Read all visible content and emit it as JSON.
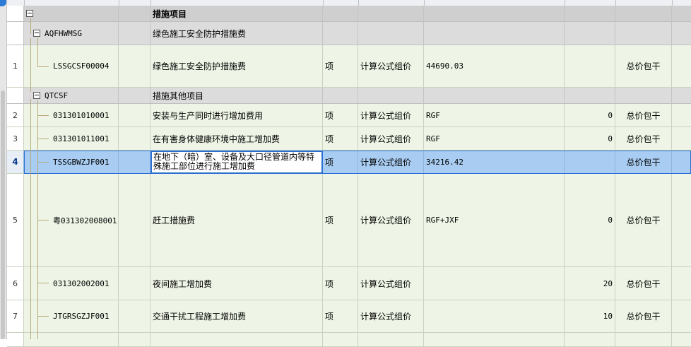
{
  "rows": [
    {
      "type": "top",
      "rownum": "",
      "code": "",
      "name": "措施项目",
      "unit": "",
      "method": "",
      "formula": "",
      "qty": "",
      "pkg": ""
    },
    {
      "type": "group",
      "rownum": "",
      "code": "AQFHWMSG",
      "name": "绿色施工安全防护措施费",
      "unit": "",
      "method": "",
      "formula": "",
      "qty": "",
      "pkg": ""
    },
    {
      "type": "item",
      "rownum": "1",
      "code": "LSSGCSF00004",
      "name": "绿色施工安全防护措施费",
      "unit": "项",
      "method": "计算公式组价",
      "formula": "44690.03",
      "qty": "",
      "pkg": "总价包干"
    },
    {
      "type": "group",
      "rownum": "",
      "code": "QTCSF",
      "name": "措施其他项目",
      "unit": "",
      "method": "",
      "formula": "",
      "qty": "",
      "pkg": ""
    },
    {
      "type": "item",
      "rownum": "2",
      "code": "031301010001",
      "name": "安装与生产同时进行增加费用",
      "unit": "项",
      "method": "计算公式组价",
      "formula": "RGF",
      "qty": "0",
      "pkg": "总价包干"
    },
    {
      "type": "item",
      "rownum": "3",
      "code": "031301011001",
      "name": "在有害身体健康环境中施工增加费",
      "unit": "项",
      "method": "计算公式组价",
      "formula": "RGF",
      "qty": "0",
      "pkg": "总价包干"
    },
    {
      "type": "sel",
      "rownum": "4",
      "code": "TSSGBWZJF001",
      "name": "在地下（暗）室、设备及大口径管道内等特殊施工部位进行施工增加费",
      "unit": "项",
      "method": "计算公式组价",
      "formula": "34216.42",
      "qty": "",
      "pkg": "总价包干"
    },
    {
      "type": "item",
      "rownum": "5",
      "code": "粤031302008001",
      "name": "赶工措施费",
      "unit": "项",
      "method": "计算公式组价",
      "formula": "RGF+JXF",
      "qty": "0",
      "pkg": "总价包干"
    },
    {
      "type": "item",
      "rownum": "6",
      "code": "031302002001",
      "name": "夜间施工增加费",
      "unit": "项",
      "method": "计算公式组价",
      "formula": "",
      "qty": "20",
      "pkg": "总价包干"
    },
    {
      "type": "item",
      "rownum": "7",
      "code": "JTGRSGZJF001",
      "name": "交通干扰工程施工增加费",
      "unit": "项",
      "method": "计算公式组价",
      "formula": "",
      "qty": "10",
      "pkg": "总价包干"
    }
  ]
}
